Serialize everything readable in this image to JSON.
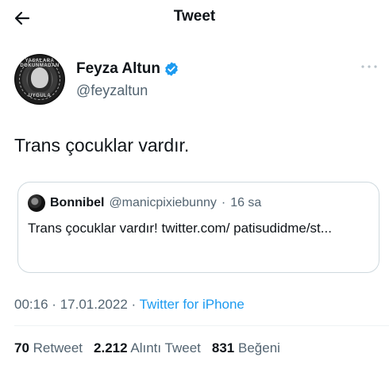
{
  "header": {
    "title": "Tweet",
    "back_icon": "arrow-left-icon"
  },
  "author": {
    "display_name": "Feyza Altun",
    "handle": "@feyzaltun",
    "verified_icon": "verified-badge-icon",
    "avatar_text_top": "YASALARA DOKUNMADAN",
    "avatar_text_bottom": "UYGULA",
    "more_icon": "more-horizontal-icon"
  },
  "tweet": {
    "text": "Trans çocuklar vardır."
  },
  "quote": {
    "name": "Bonnibel",
    "handle": "@manicpixiebunny",
    "separator": "·",
    "time": "16 sa",
    "text": "Trans çocuklar vardır! twitter.com/ patisudidme/st..."
  },
  "meta": {
    "time": "00:16",
    "separator": "·",
    "date": "17.01.2022",
    "separator2": "·",
    "source": "Twitter for iPhone"
  },
  "stats": {
    "retweets_count": "70",
    "retweets_label": "Retweet",
    "quotes_count": "2.212",
    "quotes_label": "Alıntı Tweet",
    "likes_count": "831",
    "likes_label": "Beğeni"
  },
  "colors": {
    "accent": "#1d9bf0",
    "secondary_text": "#536471",
    "border": "#cfd9de"
  }
}
